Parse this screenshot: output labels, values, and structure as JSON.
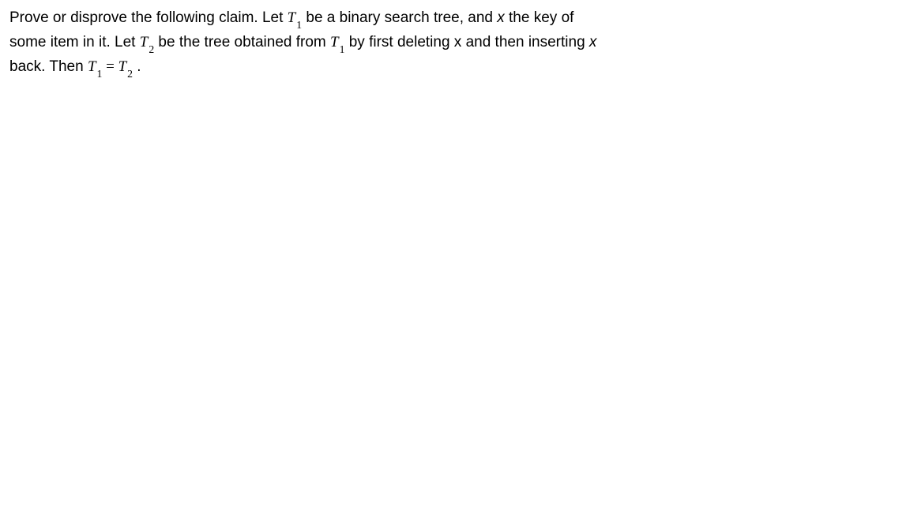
{
  "problem": {
    "part1": "Prove or disprove the following claim. Let ",
    "T1_a": "T",
    "T1_sub_a": "1",
    "part2": " be a binary search tree, and ",
    "x1": "x",
    "part3": " the key of some item in it. Let ",
    "T2": "T",
    "T2_sub": "2",
    "part4": " be the tree obtained from ",
    "T1_b": "T",
    "T1_sub_b": "1",
    "part5": " by first deleting x and then inserting ",
    "x2": "x",
    "part6": " back. Then ",
    "eq_T1": "T",
    "eq_T1_sub": "1",
    "eq_equals": " = ",
    "eq_T2": "T",
    "eq_T2_sub": "2",
    "part7": " ."
  }
}
